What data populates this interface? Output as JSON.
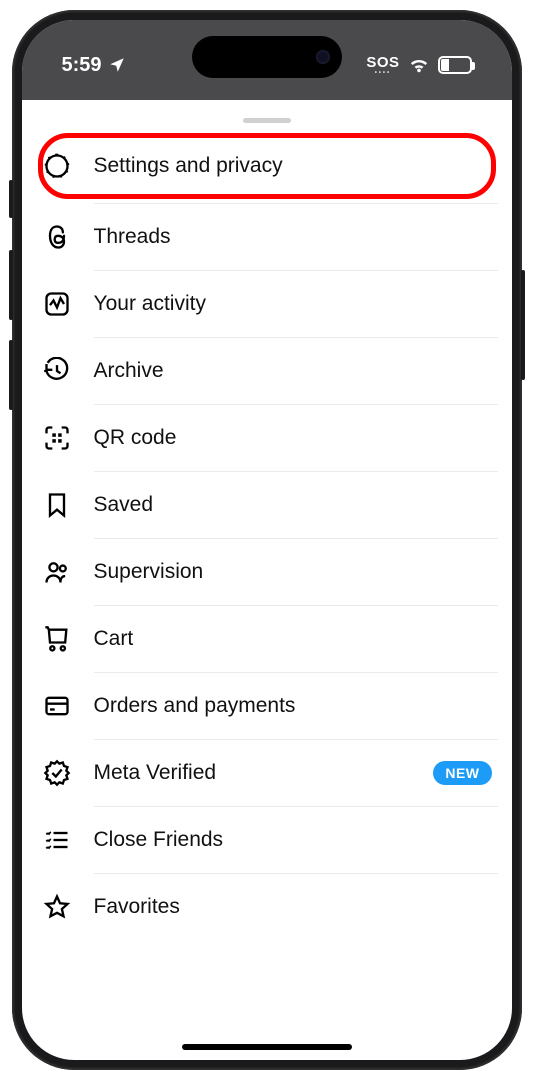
{
  "statusbar": {
    "time": "5:59",
    "sos": "SOS",
    "battery_percent": "27"
  },
  "menu": {
    "items": [
      {
        "id": "settings-privacy",
        "label": "Settings and privacy",
        "highlighted": true
      },
      {
        "id": "threads",
        "label": "Threads"
      },
      {
        "id": "your-activity",
        "label": "Your activity"
      },
      {
        "id": "archive",
        "label": "Archive"
      },
      {
        "id": "qr-code",
        "label": "QR code"
      },
      {
        "id": "saved",
        "label": "Saved"
      },
      {
        "id": "supervision",
        "label": "Supervision"
      },
      {
        "id": "cart",
        "label": "Cart"
      },
      {
        "id": "orders-payments",
        "label": "Orders and payments"
      },
      {
        "id": "meta-verified",
        "label": "Meta Verified",
        "badge": "NEW"
      },
      {
        "id": "close-friends",
        "label": "Close Friends"
      },
      {
        "id": "favorites",
        "label": "Favorites"
      }
    ]
  }
}
